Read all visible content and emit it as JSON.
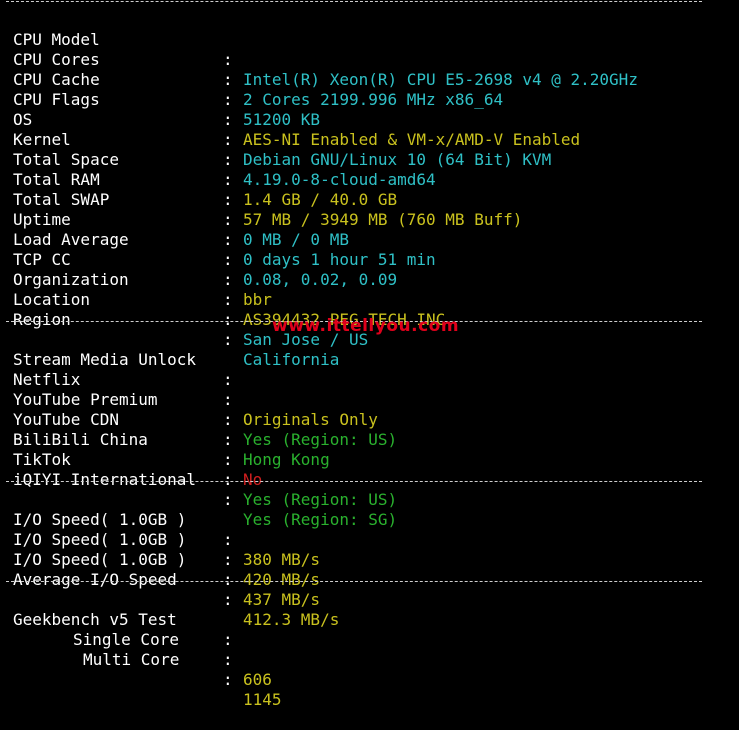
{
  "colors": {
    "background": "#000000",
    "label": "#ffffff",
    "cyan": "#2fc0c6",
    "yellow": "#c9c11e",
    "green": "#2ab12e",
    "red": "#d11f1f",
    "watermark": "#e0001b"
  },
  "colon": ":",
  "system_info": [
    {
      "key": "CPU Model",
      "value": "Intel(R) Xeon(R) CPU E5-2698 v4 @ 2.20GHz",
      "color": "cyan"
    },
    {
      "key": "CPU Cores",
      "value": "2 Cores 2199.996 MHz x86_64",
      "color": "cyan"
    },
    {
      "key": "CPU Cache",
      "value": "51200 KB",
      "color": "cyan"
    },
    {
      "key": "CPU Flags",
      "value": "AES-NI Enabled & VM-x/AMD-V Enabled",
      "color": "yellow"
    },
    {
      "key": "OS",
      "value": "Debian GNU/Linux 10 (64 Bit) KVM",
      "color": "cyan"
    },
    {
      "key": "Kernel",
      "value": "4.19.0-8-cloud-amd64",
      "color": "cyan"
    },
    {
      "key": "Total Space",
      "value": "1.4 GB / 40.0 GB",
      "color": "yellow"
    },
    {
      "key": "Total RAM",
      "value": "57 MB / 3949 MB (760 MB Buff)",
      "color": "yellow"
    },
    {
      "key": "Total SWAP",
      "value": "0 MB / 0 MB",
      "color": "cyan"
    },
    {
      "key": "Uptime",
      "value": "0 days 1 hour 51 min",
      "color": "cyan"
    },
    {
      "key": "Load Average",
      "value": "0.08, 0.02, 0.09",
      "color": "cyan"
    },
    {
      "key": "TCP CC",
      "value": "bbr",
      "color": "yellow"
    },
    {
      "key": "Organization",
      "value": "AS394432 PEG TECH INC",
      "color": "yellow"
    },
    {
      "key": "Location",
      "value": "San Jose / US",
      "color": "cyan"
    },
    {
      "key": "Region",
      "value": "California",
      "color": "cyan"
    }
  ],
  "stream_unlock": {
    "title": "Stream Media Unlock",
    "items": [
      {
        "key": "Netflix",
        "value": "Originals Only",
        "color": "yellow"
      },
      {
        "key": "YouTube Premium",
        "value": "Yes (Region: US)",
        "color": "green"
      },
      {
        "key": "YouTube CDN",
        "value": "Hong Kong",
        "color": "green"
      },
      {
        "key": "BiliBili China",
        "value": "No",
        "color": "red"
      },
      {
        "key": "TikTok",
        "value": "Yes (Region: US)",
        "color": "green"
      },
      {
        "key": "iQIYI International",
        "value": "Yes (Region: SG)",
        "color": "green"
      }
    ]
  },
  "watermark": "www.ittellyou.com",
  "io_speed": [
    {
      "key": "I/O Speed( 1.0GB )",
      "value": "380 MB/s",
      "color": "yellow"
    },
    {
      "key": "I/O Speed( 1.0GB )",
      "value": "420 MB/s",
      "color": "yellow"
    },
    {
      "key": "I/O Speed( 1.0GB )",
      "value": "437 MB/s",
      "color": "yellow"
    },
    {
      "key": "Average I/O Speed",
      "value": "412.3 MB/s",
      "color": "yellow"
    }
  ],
  "geekbench": {
    "title": "Geekbench v5 Test",
    "single_label": "Single Core",
    "single_value": "606",
    "multi_label": "Multi Core",
    "multi_value": "1145",
    "color": "yellow"
  }
}
